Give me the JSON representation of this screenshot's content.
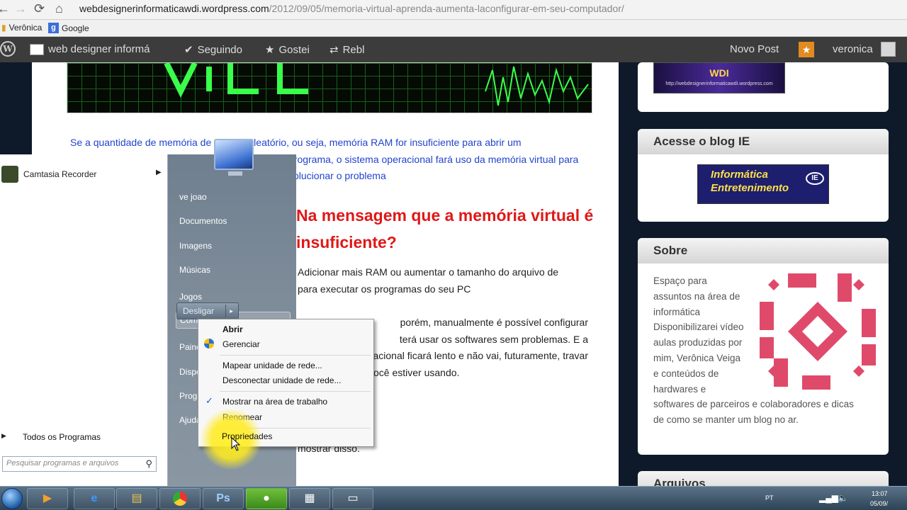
{
  "browser": {
    "url_host": "webdesignerinformaticawdi.wordpress.com",
    "url_path": "/2012/09/05/memoria-virtual-aprenda-aumenta-laconfigurar-em-seu-computador/",
    "bookmarks": [
      "Verônica",
      "Google"
    ]
  },
  "wp_bar": {
    "site_name": "web designer informá",
    "following": "Seguindo",
    "liked": "Gostei",
    "reblog": "Rebl",
    "new_post": "Novo Post",
    "username": "veronica"
  },
  "article": {
    "para1": [
      "Se  a quantidade de memória de acesso aleatório, ou seja,  memória RAM for insuficiente  para abrir  um",
      "programa, o sistema operacional fará uso  da memória virtual para",
      "solucionar o problema"
    ],
    "heading": [
      "Na mensagem que a memória virtual é",
      "insuficiente?"
    ],
    "para2": [
      "Adicionar mais RAM ou aumentar o tamanho do arquivo de",
      "para executar os programas do seu PC"
    ],
    "para3": [
      "porém, manualmente é possível configurar",
      "terá usar os softwares sem problemas. E a",
      "sistema operacional ficará lento e não vai, futuramente, travar",
      "você estiver usando."
    ],
    "para4": "mostrar disso."
  },
  "sidebar": {
    "wdi_logo": "WDI",
    "wdi_caption": "http://webdesignerinformaticawdi.wordpress.com",
    "blog_ie_title": "Acesse o blog IE",
    "ie_logo": [
      "Informática",
      "Entretenimento"
    ],
    "ie_badge": "IE",
    "sobre_title": "Sobre",
    "sobre_lines": [
      "Espaço para",
      "assuntos na área de",
      "informática",
      "Disponibilizarei vídeo",
      "aulas produzidas por",
      "mim, Verônica Veiga",
      "e conteúdos de",
      "hardwares e",
      "softwares de parceiros e colaboradores e dicas",
      "de como se manter um blog no ar."
    ],
    "arquivos_title": "Arquivos"
  },
  "start_menu": {
    "pinned_program": "Camtasia Recorder",
    "all_programs": "Todos os Programas",
    "search_placeholder": "Pesquisar programas e arquivos",
    "right_items": [
      "ve joao",
      "Documentos",
      "Imagens",
      "Músicas",
      "Jogos",
      "Computador",
      "Painel",
      "Dispo",
      "Prog",
      "Ajuda"
    ],
    "shutdown": "Desligar"
  },
  "context_menu": {
    "items": [
      {
        "label": "Abrir",
        "bold": true
      },
      {
        "label": "Gerenciar"
      },
      {
        "label": "Mapear unidade de rede..."
      },
      {
        "label": "Desconectar unidade de rede..."
      },
      {
        "label": "Mostrar na área de trabalho",
        "checked": true
      },
      {
        "label": "Renomear"
      },
      {
        "label": "Propriedades"
      }
    ]
  },
  "taskbar": {
    "tray_lang": "PT",
    "clock_time": "13:07",
    "clock_date": "05/09/"
  },
  "colors": {
    "link_blue": "#2244cc",
    "heading_red": "#e01818",
    "wp_bar": "#3c3c3c",
    "notification_orange": "#e38a20"
  }
}
